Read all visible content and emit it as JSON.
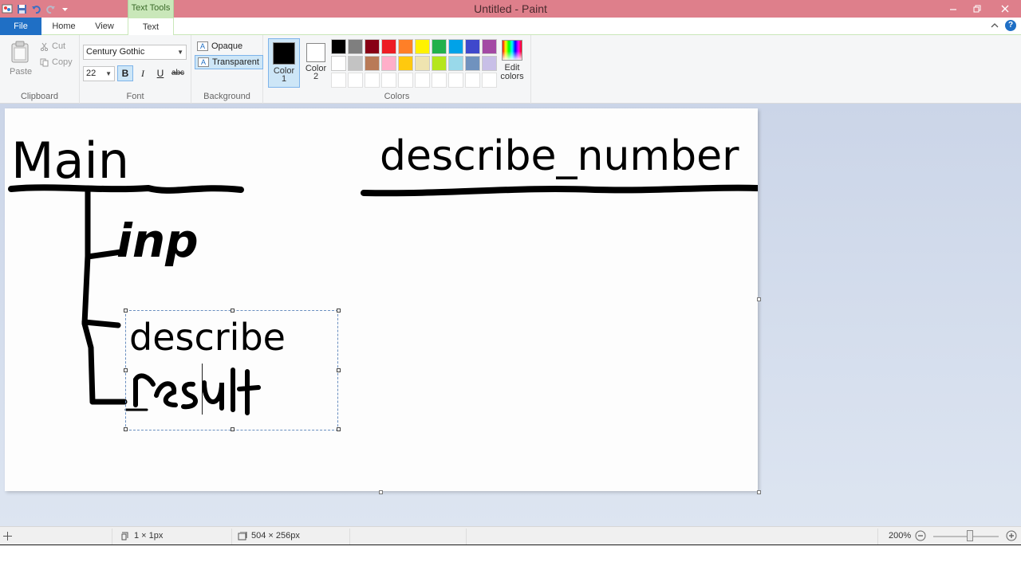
{
  "window": {
    "title": "Untitled - Paint",
    "context_tab": "Text Tools"
  },
  "tabs": {
    "file": "File",
    "home": "Home",
    "view": "View",
    "text": "Text"
  },
  "clipboard": {
    "paste": "Paste",
    "cut": "Cut",
    "copy": "Copy",
    "label": "Clipboard"
  },
  "font": {
    "family": "Century Gothic",
    "size": "22",
    "bold": "B",
    "italic": "I",
    "underline": "U",
    "strike": "abc",
    "label": "Font"
  },
  "background": {
    "opaque": "Opaque",
    "transparent": "Transparent",
    "label": "Background"
  },
  "colors": {
    "color1_line1": "Color",
    "color1_line2": "1",
    "color2_line1": "Color",
    "color2_line2": "2",
    "color1_value": "#000000",
    "color2_value": "#ffffff",
    "edit_line1": "Edit",
    "edit_line2": "colors",
    "label": "Colors",
    "palette": [
      "#000000",
      "#7f7f7f",
      "#880015",
      "#ed1c24",
      "#ff7f27",
      "#fff200",
      "#22b14c",
      "#00a2e8",
      "#3f48cc",
      "#a349a4",
      "#ffffff",
      "#c3c3c3",
      "#b97a57",
      "#ffaec9",
      "#ffc90e",
      "#efe4b0",
      "#b5e61d",
      "#99d9ea",
      "#7092be",
      "#c8bfe7",
      "#ffffff",
      "#ffffff",
      "#ffffff",
      "#ffffff",
      "#ffffff",
      "#ffffff",
      "#ffffff",
      "#ffffff",
      "#ffffff",
      "#ffffff"
    ]
  },
  "canvas": {
    "text_main": "Main",
    "text_inp": "inp",
    "text_function": "describe_number",
    "text_describe": "describe",
    "text_result": "result"
  },
  "status": {
    "cursor_size": "1 × 1px",
    "selection_size": "504 × 256px",
    "zoom": "200%"
  }
}
